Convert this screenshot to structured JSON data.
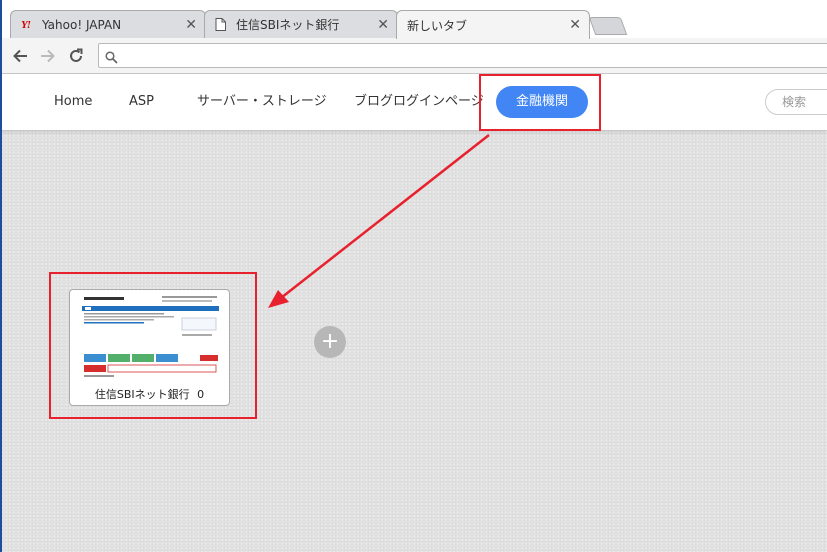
{
  "tabs": [
    {
      "label": "Yahoo! JAPAN",
      "icon": "yahoo-favicon",
      "close": "✕",
      "favicon_text": "Y!"
    },
    {
      "label": "住信SBIネット銀行",
      "icon": "page-icon",
      "close": "✕"
    },
    {
      "label": "新しいタブ",
      "close": "✕"
    }
  ],
  "omnibox": {
    "value": "",
    "placeholder": ""
  },
  "nav": {
    "items": [
      "Home",
      "ASP",
      "サーバー・ストレージ",
      "ブログログインページ",
      "金融機関"
    ],
    "active": "金融機関",
    "search_placeholder": "検索"
  },
  "bookmark": {
    "title": "住信SBIネット銀行",
    "count": "0"
  },
  "add_label": "+",
  "colors": {
    "accent": "#4285f4",
    "highlight": "#e8212e",
    "tab_yahoo": "#d10000"
  }
}
